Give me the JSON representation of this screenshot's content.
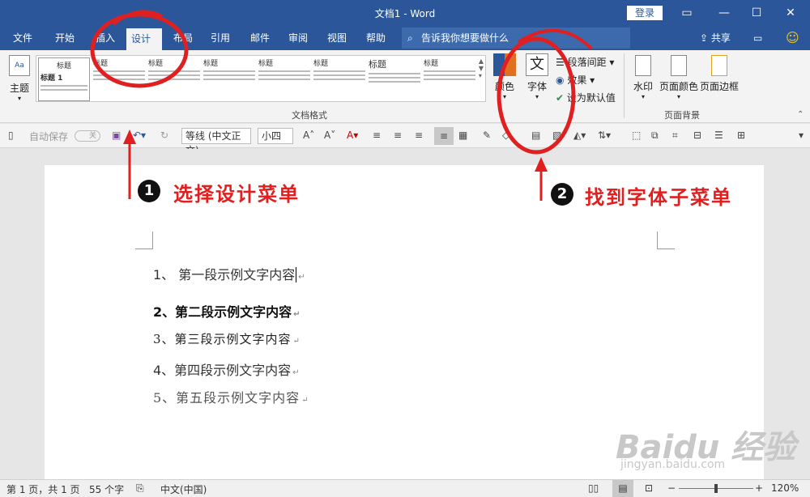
{
  "titlebar": {
    "title": "文档1  -  Word",
    "login": "登录"
  },
  "tabs": [
    "文件",
    "开始",
    "插入",
    "设计",
    "布局",
    "引用",
    "邮件",
    "审阅",
    "视图",
    "帮助"
  ],
  "search": {
    "placeholder": "告诉我你想要做什么"
  },
  "share": "共享",
  "ribbon": {
    "theme_label": "主题",
    "doc_format_label": "文档格式",
    "style_title": "标题",
    "style_title1": "标题 1",
    "colors_label": "颜色",
    "fonts_label": "字体",
    "fonts_icon_char": "文",
    "para_spacing_label": "段落间距",
    "effects_label": "效果",
    "set_default_label": "设为默认值",
    "watermark_label": "水印",
    "page_color_label": "页面颜色",
    "page_border_label": "页面边框",
    "page_bg_label": "页面背景"
  },
  "qat": {
    "autosave": "自动保存",
    "autosave_state": "关",
    "font": "等线 (中文正文)",
    "size": "小四"
  },
  "document": {
    "paragraphs": [
      "1、 第一段示例文字内容",
      "2、第二段示例文字内容",
      "3、第三段示例文字内容",
      "4、第四段示例文字内容",
      "5、第五段示例文字内容"
    ]
  },
  "annotations": {
    "step1_num": "1",
    "step1_text": "选择设计菜单",
    "step2_num": "2",
    "step2_text": "找到字体子菜单",
    "color": "#e02020"
  },
  "status": {
    "page": "第 1 页，共 1 页",
    "words": "55 个字",
    "lang": "中文(中国)",
    "zoom": "120%"
  },
  "watermark": {
    "brand": "Baidu 经验",
    "url": "jingyan.baidu.com"
  },
  "colors": {
    "word_blue": "#2b579a",
    "ribbon_bg": "#f3f3f3",
    "annotation_red": "#e02020"
  }
}
